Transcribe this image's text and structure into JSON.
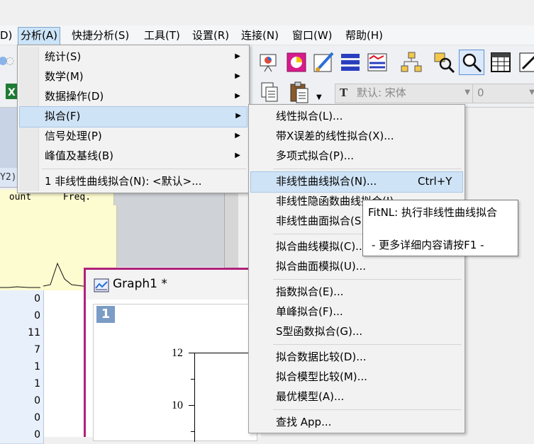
{
  "menubar": {
    "items": [
      "D)",
      "分析(A)",
      "快捷分析(S)",
      "工具(T)",
      "设置(R)",
      "连接(N)",
      "窗口(W)",
      "帮助(H)"
    ]
  },
  "toolbar2": {
    "font_combo": "默认: 宋体",
    "size_combo": "0"
  },
  "worksheet": {
    "partial_tab": "Y2)",
    "col_headers": [
      "ount",
      "Freq."
    ],
    "values": [
      "0",
      "0",
      "11",
      "7",
      "1",
      "1",
      "0",
      "0",
      "0"
    ]
  },
  "graph": {
    "title": "Graph1 *",
    "layer": "1",
    "y_ticks": [
      "12",
      "10"
    ]
  },
  "analysis_menu": {
    "items": [
      {
        "label": "统计(S)",
        "submenu": true
      },
      {
        "label": "数学(M)",
        "submenu": true
      },
      {
        "label": "数据操作(D)",
        "submenu": true
      },
      {
        "label": "拟合(F)",
        "submenu": true
      },
      {
        "label": "信号处理(P)",
        "submenu": true
      },
      {
        "label": "峰值及基线(B)",
        "submenu": true
      }
    ],
    "recent": "1 非线性曲线拟合(N): <默认>..."
  },
  "fit_menu": {
    "items": [
      "线性拟合(L)...",
      "带X误差的线性拟合(X)...",
      "多项式拟合(P)...",
      "非线性曲线拟合(N)...",
      "非线性隐函数曲线拟合(I)...",
      "非线性曲面拟合(S)...",
      "拟合曲线模拟(C)...",
      "拟合曲面模拟(U)...",
      "指数拟合(E)...",
      "单峰拟合(F)...",
      "S型函数拟合(G)...",
      "拟合数据比较(D)...",
      "拟合模型比较(M)...",
      "最优模型(A)...",
      "查找 App..."
    ],
    "shortcut": "Ctrl+Y"
  },
  "tooltip": {
    "line1": "FitNL: 执行非线性曲线拟合",
    "line2": "- 更多详细内容请按F1 -"
  },
  "colors": {
    "menu_highlight": "#cfe3f6",
    "graph_border": "#b0217a",
    "sheet_yellow": "#fdfbd0"
  }
}
